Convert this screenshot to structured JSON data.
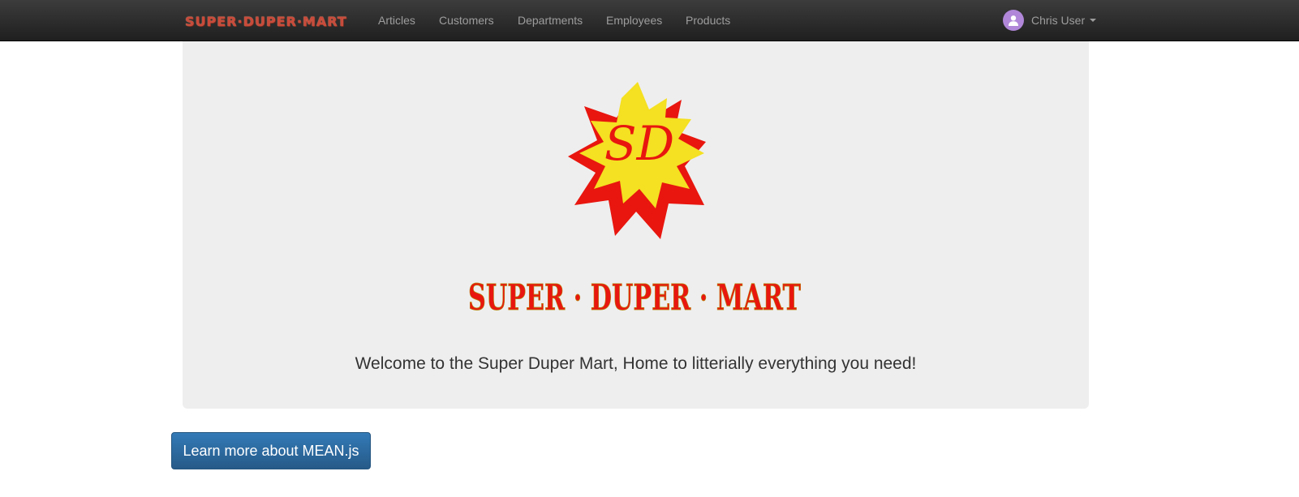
{
  "navbar": {
    "brand": "SUPER·DUPER·MART",
    "links": [
      "Articles",
      "Customers",
      "Departments",
      "Employees",
      "Products"
    ],
    "user": {
      "name": "Chris User",
      "icon": "user-avatar-icon",
      "dropdown_icon": "caret-down-icon"
    }
  },
  "hero": {
    "logo_monogram": "SD",
    "logo_wordmark": "SUPER · DUPER · MART",
    "welcome": "Welcome to the Super Duper Mart, Home to litterially everything you need!"
  },
  "cta": {
    "label": "Learn more about MEAN.js"
  },
  "colors": {
    "navbar": "#222222",
    "jumbotron": "#eeeeee",
    "primary": "#337ab7",
    "logo_red": "#e8160f",
    "logo_yellow": "#f5e021",
    "avatar": "#b087d9"
  }
}
